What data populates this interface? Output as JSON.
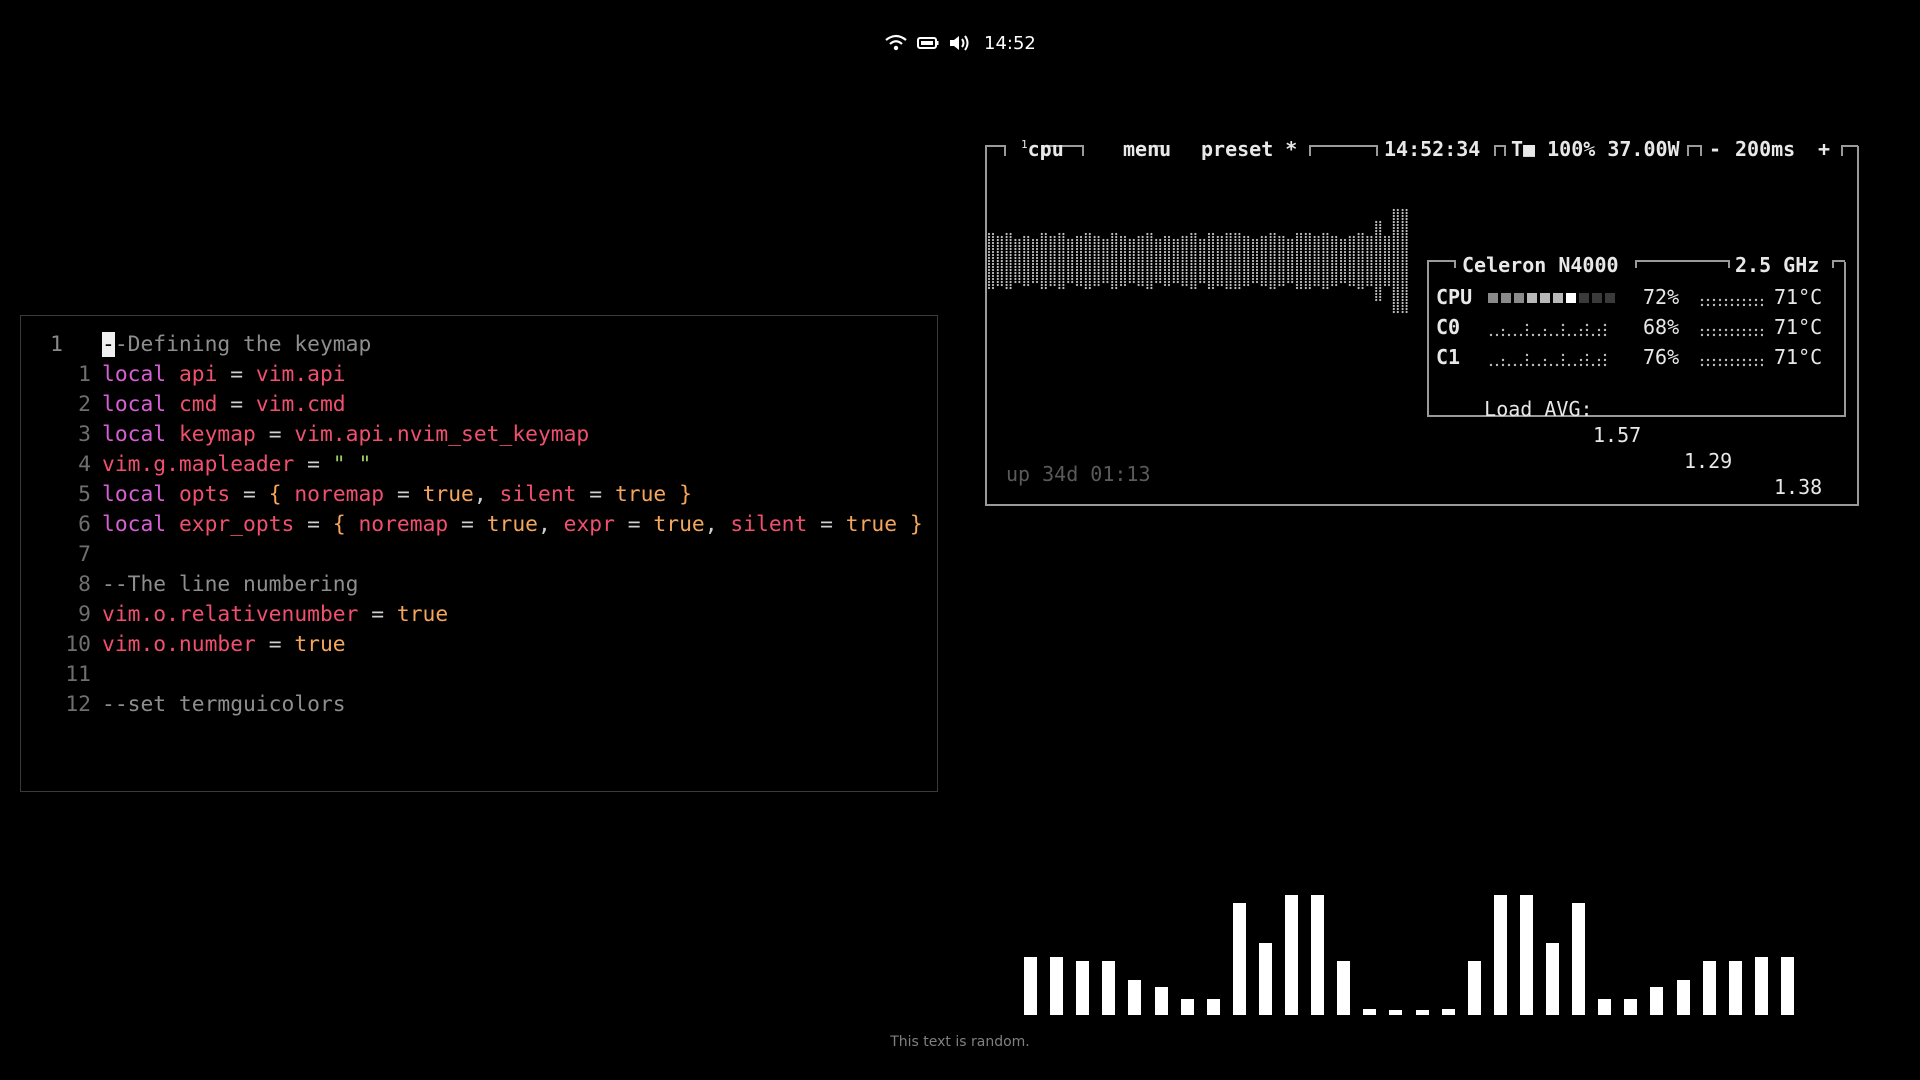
{
  "statusbar": {
    "icons": [
      "wifi-icon",
      "battery-icon",
      "volume-icon"
    ],
    "clock": "14:52"
  },
  "editor": {
    "lines": [
      {
        "num": "1",
        "current": true,
        "segments": [
          [
            "cursor",
            "-"
          ],
          [
            "c-com",
            "-Defining the keymap"
          ]
        ]
      },
      {
        "num": "1",
        "segments": [
          [
            "c-kw",
            "local"
          ],
          [
            "c-op",
            " "
          ],
          [
            "c-id",
            "api"
          ],
          [
            "c-op",
            " = "
          ],
          [
            "c-id",
            "vim.api"
          ]
        ]
      },
      {
        "num": "2",
        "segments": [
          [
            "c-kw",
            "local"
          ],
          [
            "c-op",
            " "
          ],
          [
            "c-id",
            "cmd"
          ],
          [
            "c-op",
            " = "
          ],
          [
            "c-id",
            "vim.cmd"
          ]
        ]
      },
      {
        "num": "3",
        "segments": [
          [
            "c-kw",
            "local"
          ],
          [
            "c-op",
            " "
          ],
          [
            "c-id",
            "keymap"
          ],
          [
            "c-op",
            " = "
          ],
          [
            "c-id",
            "vim.api.nvim_set_keymap"
          ]
        ]
      },
      {
        "num": "4",
        "segments": [
          [
            "c-id",
            "vim.g.mapleader"
          ],
          [
            "c-op",
            " = "
          ],
          [
            "c-str",
            "\" \""
          ]
        ]
      },
      {
        "num": "5",
        "segments": [
          [
            "c-kw",
            "local"
          ],
          [
            "c-op",
            " "
          ],
          [
            "c-id",
            "opts"
          ],
          [
            "c-op",
            " = "
          ],
          [
            "c-val",
            "{"
          ],
          [
            "c-op",
            " "
          ],
          [
            "c-id",
            "noremap"
          ],
          [
            "c-op",
            " = "
          ],
          [
            "c-val",
            "true"
          ],
          [
            "c-op",
            ", "
          ],
          [
            "c-id",
            "silent"
          ],
          [
            "c-op",
            " = "
          ],
          [
            "c-val",
            "true"
          ],
          [
            "c-op",
            " "
          ],
          [
            "c-val",
            "}"
          ]
        ]
      },
      {
        "num": "6",
        "segments": [
          [
            "c-kw",
            "local"
          ],
          [
            "c-op",
            " "
          ],
          [
            "c-id",
            "expr_opts"
          ],
          [
            "c-op",
            " = "
          ],
          [
            "c-val",
            "{"
          ],
          [
            "c-op",
            " "
          ],
          [
            "c-id",
            "noremap"
          ],
          [
            "c-op",
            " = "
          ],
          [
            "c-val",
            "true"
          ],
          [
            "c-op",
            ", "
          ],
          [
            "c-id",
            "expr"
          ],
          [
            "c-op",
            " = "
          ],
          [
            "c-val",
            "true"
          ],
          [
            "c-op",
            ", "
          ],
          [
            "c-id",
            "silent"
          ],
          [
            "c-op",
            " = "
          ],
          [
            "c-val",
            "true"
          ],
          [
            "c-op",
            " "
          ],
          [
            "c-val",
            "}"
          ]
        ]
      },
      {
        "num": "7",
        "segments": []
      },
      {
        "num": "8",
        "segments": [
          [
            "c-com",
            "--The line numbering"
          ]
        ]
      },
      {
        "num": "9",
        "segments": [
          [
            "c-id",
            "vim.o.relativenumber"
          ],
          [
            "c-op",
            " = "
          ],
          [
            "c-val",
            "true"
          ]
        ]
      },
      {
        "num": "10",
        "segments": [
          [
            "c-id",
            "vim.o.number"
          ],
          [
            "c-op",
            " = "
          ],
          [
            "c-val",
            "true"
          ]
        ]
      },
      {
        "num": "11",
        "segments": []
      },
      {
        "num": "12",
        "segments": [
          [
            "c-com",
            "--set termguicolors"
          ]
        ]
      }
    ]
  },
  "btop": {
    "tab_num": "1",
    "tab_cpu": "cpu",
    "tab_menu": "menu",
    "tab_preset": "preset *",
    "time": "14:52:34",
    "battery": "T■ 100% 37.00W",
    "refresh_minus": "-",
    "refresh": "200ms",
    "refresh_plus": "+",
    "cpu_model": "Celeron N4000",
    "freq": "2.5 GHz",
    "rows": [
      {
        "label": "CPU",
        "pct": "72%",
        "temp": "71°C",
        "level": 0.72
      },
      {
        "label": "C0",
        "pct": "68%",
        "temp": "71°C",
        "level": 0.68
      },
      {
        "label": "C1",
        "pct": "76%",
        "temp": "71°C",
        "level": 0.76
      }
    ],
    "load_label": "Load AVG:",
    "load": [
      "1.57",
      "1.29",
      "1.38"
    ],
    "uptime": "up 34d 01:13",
    "graph_levels": [
      0.55,
      0.45,
      0.5,
      0.4,
      0.45,
      0.4,
      0.5,
      0.45,
      0.55,
      0.4,
      0.45,
      0.5,
      0.45,
      0.4,
      0.5,
      0.45,
      0.4,
      0.45,
      0.5,
      0.4,
      0.45,
      0.4,
      0.45,
      0.5,
      0.4,
      0.5,
      0.45,
      0.55,
      0.5,
      0.45,
      0.4,
      0.45,
      0.5,
      0.45,
      0.4,
      0.5,
      0.55,
      0.45,
      0.5,
      0.45,
      0.4,
      0.45,
      0.5,
      0.45,
      0.75,
      0.45,
      1.0,
      1.0
    ]
  },
  "visualizer": {
    "levels": [
      0.48,
      0.48,
      0.45,
      0.45,
      0.29,
      0.23,
      0.13,
      0.13,
      0.93,
      0.6,
      1.0,
      1.0,
      0.45,
      0.05,
      0.04,
      0.04,
      0.05,
      0.45,
      1.0,
      1.0,
      0.6,
      0.93,
      0.13,
      0.13,
      0.23,
      0.29,
      0.45,
      0.45,
      0.48,
      0.48
    ]
  },
  "caption": "This text is random."
}
